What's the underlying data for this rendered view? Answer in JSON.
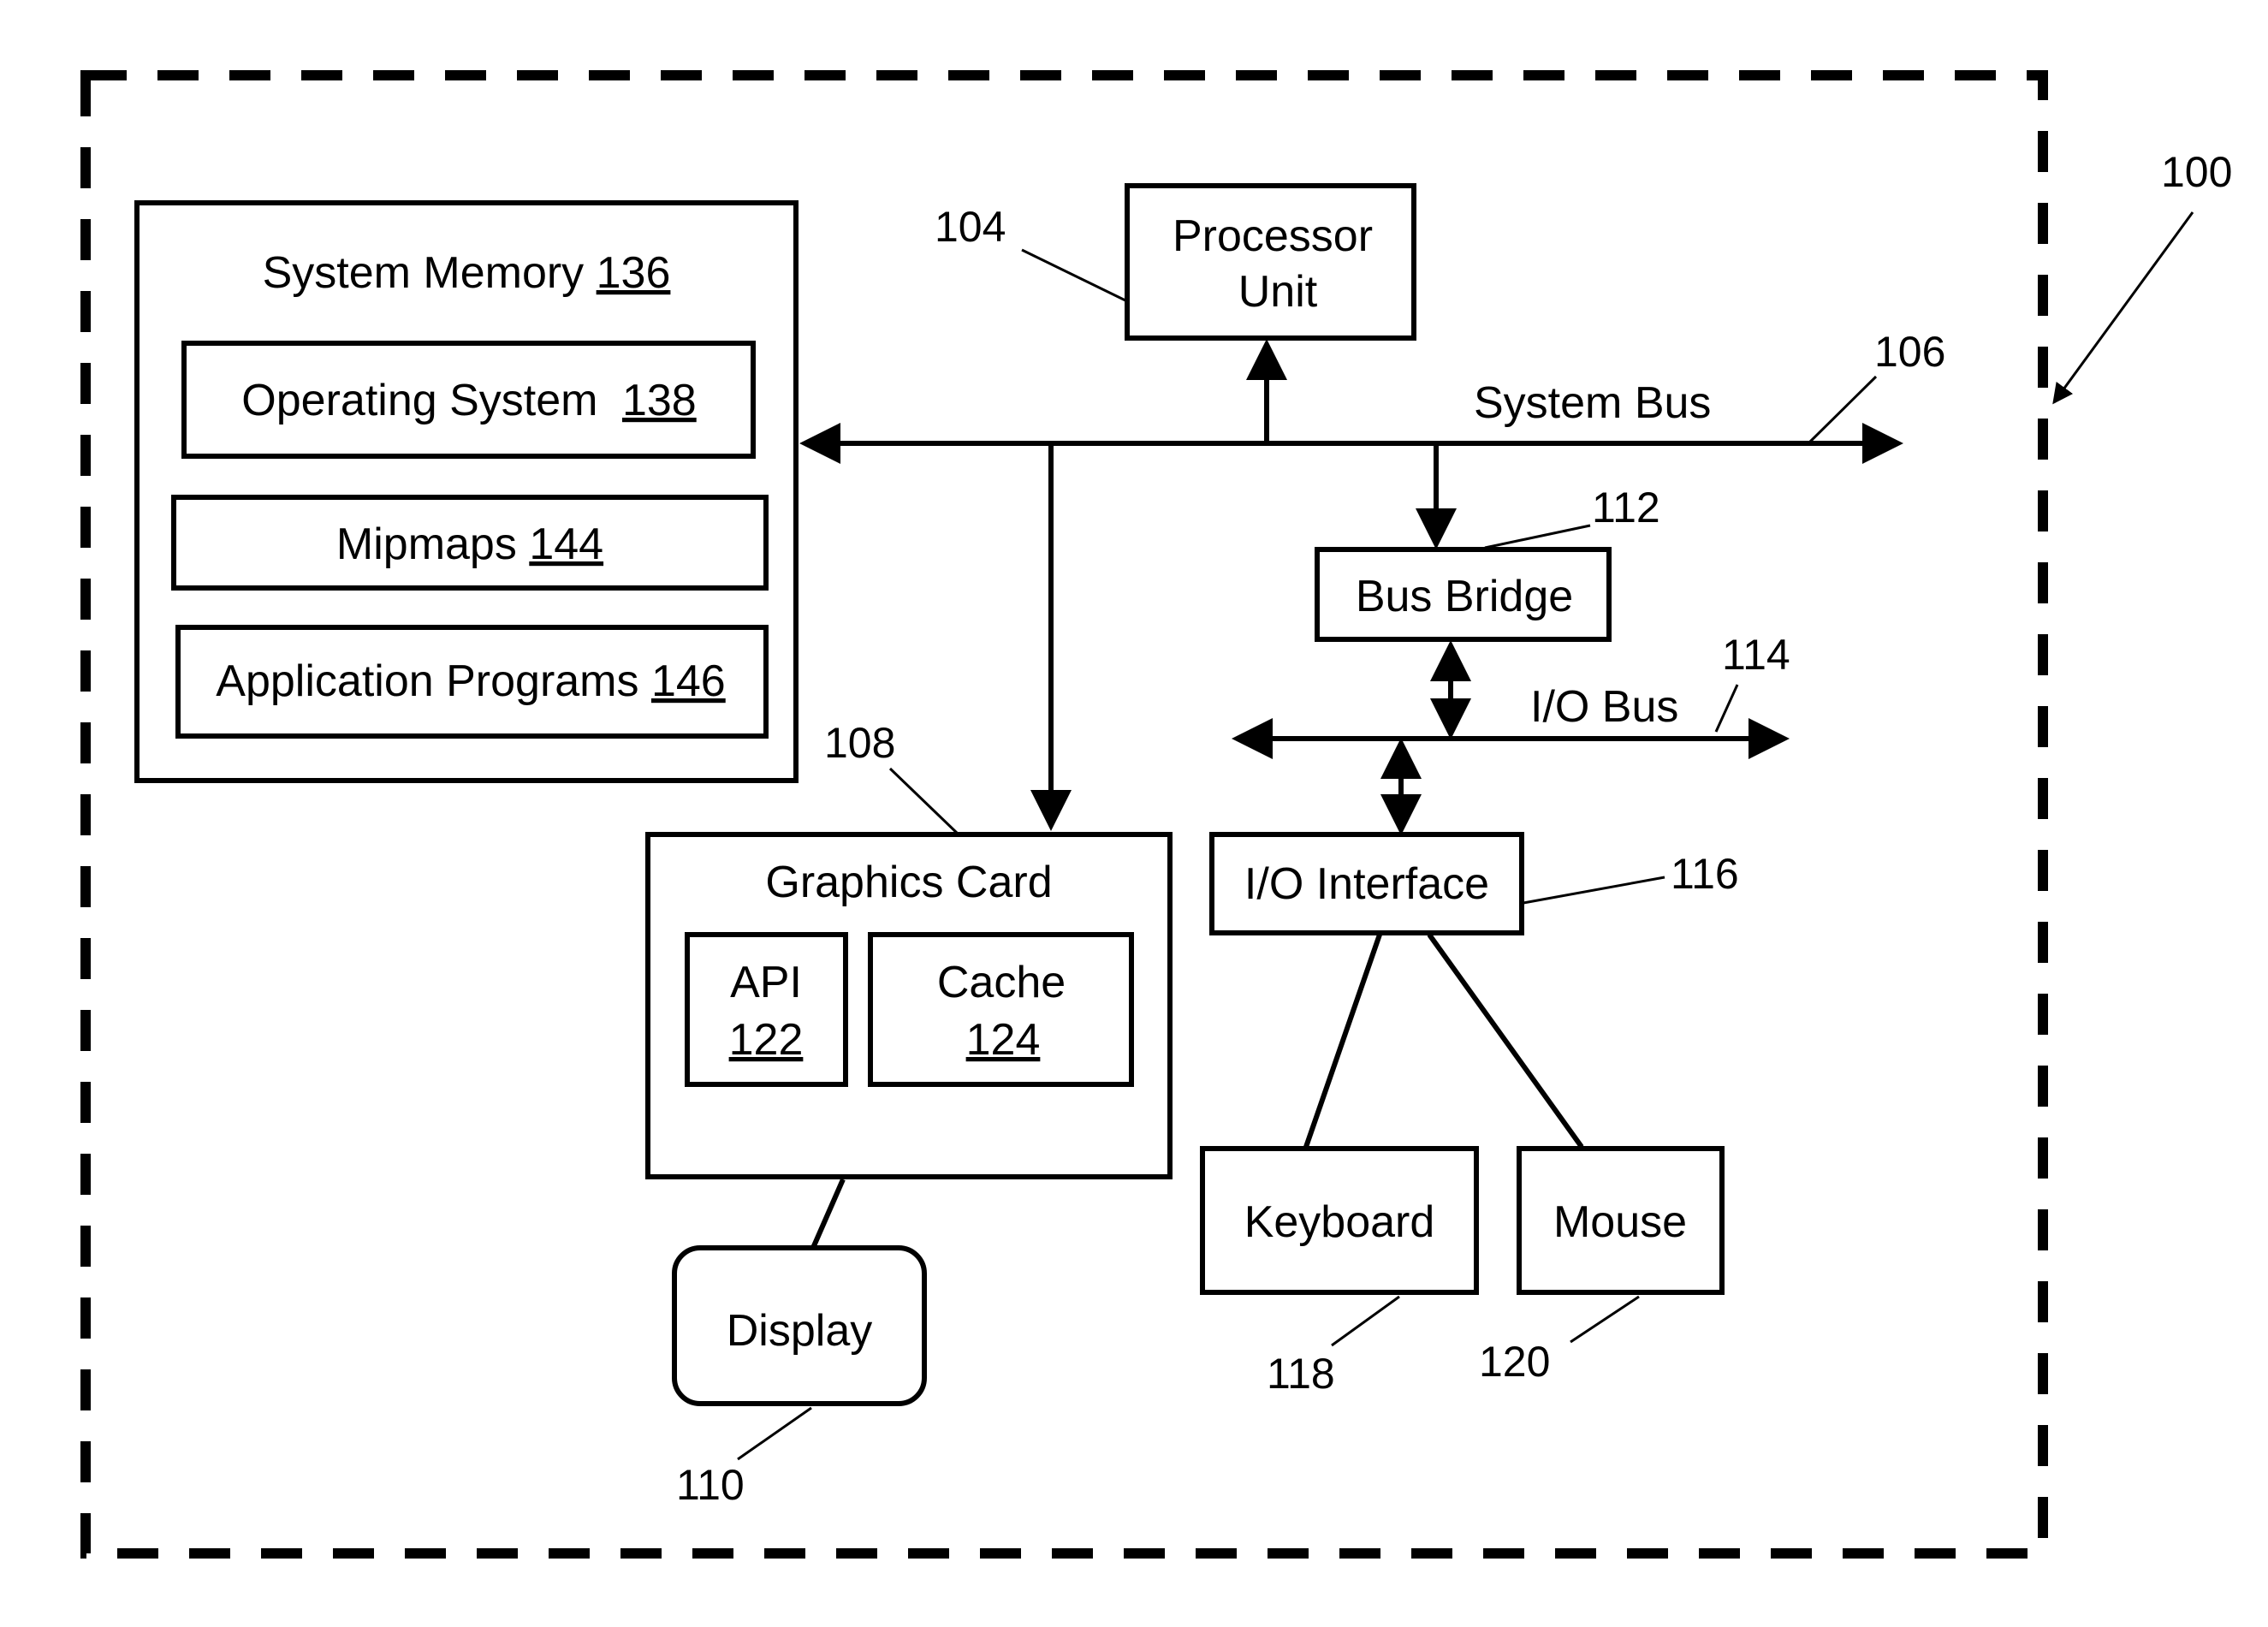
{
  "figure": {
    "ref": "100"
  },
  "system_memory": {
    "title": "System Memory",
    "ref": "136",
    "items": [
      {
        "label": "Operating System",
        "ref": "138"
      },
      {
        "label": "Mipmaps",
        "ref": "144"
      },
      {
        "label": "Application Programs",
        "ref": "146"
      }
    ]
  },
  "processor": {
    "line1": "Processor",
    "line2": "Unit",
    "ref": "104"
  },
  "system_bus": {
    "label": "System Bus",
    "ref": "106"
  },
  "bus_bridge": {
    "label": "Bus Bridge",
    "ref": "112"
  },
  "io_bus": {
    "label": "I/O Bus",
    "ref": "114"
  },
  "graphics_card": {
    "label": "Graphics Card",
    "ref": "108",
    "api": {
      "label": "API",
      "ref": "122"
    },
    "cache": {
      "label": "Cache",
      "ref": "124"
    }
  },
  "display": {
    "label": "Display",
    "ref": "110"
  },
  "io_interface": {
    "label": "I/O Interface",
    "ref": "116"
  },
  "keyboard": {
    "label": "Keyboard",
    "ref": "118"
  },
  "mouse": {
    "label": "Mouse",
    "ref": "120"
  }
}
